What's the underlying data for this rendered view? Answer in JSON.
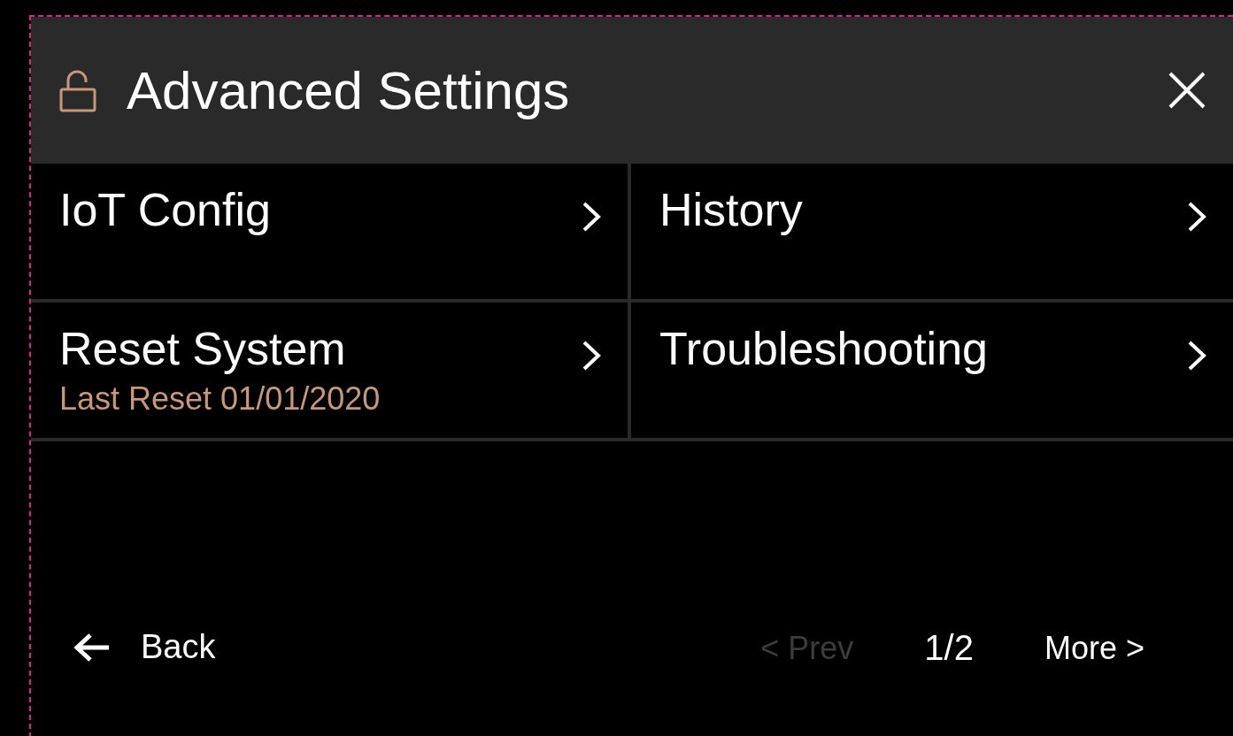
{
  "header": {
    "title": "Advanced Settings"
  },
  "items": [
    {
      "label": "IoT Config"
    },
    {
      "label": "History"
    },
    {
      "label": "Reset System",
      "subtitle": "Last Reset 01/01/2020"
    },
    {
      "label": "Troubleshooting"
    }
  ],
  "footer": {
    "back": "Back",
    "prev": {
      "label": "< Prev",
      "disabled": true
    },
    "page": "1/2",
    "next": {
      "label": "More >",
      "disabled": false
    }
  }
}
